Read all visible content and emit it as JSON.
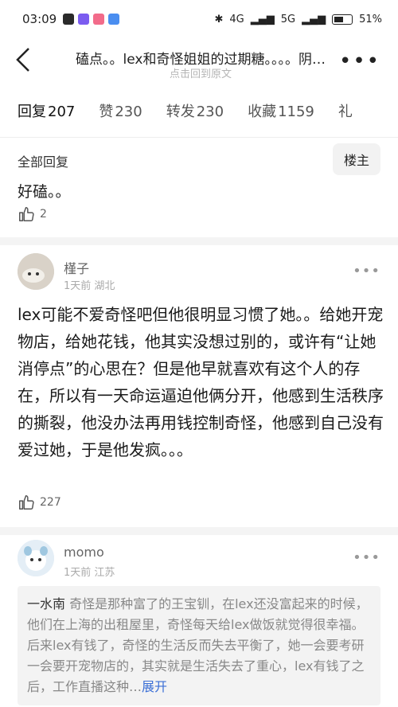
{
  "status": {
    "time": "03:09",
    "signal_4g": "4G",
    "signal_5g": "5G",
    "battery": "51%"
  },
  "header": {
    "title": "磕点。。lex和奇怪姐姐的过期糖。。。。阴…",
    "subtitle": "点击回到原文"
  },
  "tabs": [
    {
      "label": "回复",
      "count": "207"
    },
    {
      "label": "赞",
      "count": "230"
    },
    {
      "label": "转发",
      "count": "230"
    },
    {
      "label": "收藏",
      "count": "1159"
    },
    {
      "label": "礼",
      "count": ""
    }
  ],
  "op": {
    "section_label": "全部回复",
    "badge": "楼主",
    "text": "好磕。。",
    "likes": "2"
  },
  "comment1": {
    "username": "槿子",
    "time": "1天前",
    "location": "湖北",
    "text": "lex可能不爱奇怪吧但他很明显习惯了她。。给她开宠物店，给她花钱，他其实没想过别的，或许有“让她消停点”的心思在？但是他早就喜欢有这个人的存在，所以有一天命运逼迫他俩分开，他感到生活秩序的撕裂，他没办法再用钱控制奇怪，他感到自己没有爱过她，于是他发疯。。。",
    "likes": "227"
  },
  "comment2": {
    "username": "momo",
    "time": "1天前",
    "location": "江苏",
    "reply_author": "一水南",
    "reply_text": "奇怪是那种富了的王宝钏，在lex还没富起来的时候，他们在上海的出租屋里，奇怪每天给lex做饭就觉得很幸福。后来lex有钱了，奇怪的生活反而失去平衡了，她一会要考研一会要开宠物店的，其实就是生活失去了重心，lex有钱了之后，工作直播这种…",
    "expand": "展开"
  },
  "colors": {
    "accent": "#3b6fd6"
  }
}
